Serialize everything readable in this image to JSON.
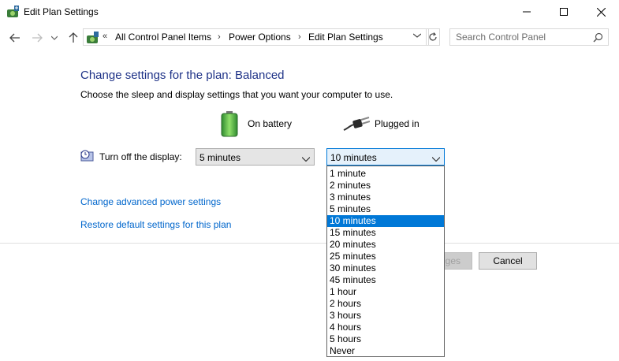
{
  "window": {
    "title": "Edit Plan Settings",
    "controls": [
      "minimize",
      "maximize",
      "close"
    ]
  },
  "nav": {
    "breadcrumb_overflow": "«",
    "breadcrumbs": [
      "All Control Panel Items",
      "Power Options",
      "Edit Plan Settings"
    ],
    "search_placeholder": "Search Control Panel"
  },
  "content": {
    "heading": "Change settings for the plan: Balanced",
    "subheading": "Choose the sleep and display settings that you want your computer to use.",
    "columns": {
      "battery": "On battery",
      "plugged": "Plugged in"
    },
    "display_setting": {
      "label": "Turn off the display:",
      "battery_value": "5 minutes",
      "plugged_value": "10 minutes"
    },
    "links": {
      "advanced": "Change advanced power settings",
      "restore": "Restore default settings for this plan"
    },
    "buttons": {
      "save_partial": "ges",
      "cancel": "Cancel"
    }
  },
  "dropdown": {
    "selected_index": 4,
    "options": [
      "1 minute",
      "2 minutes",
      "3 minutes",
      "5 minutes",
      "10 minutes",
      "15 minutes",
      "20 minutes",
      "25 minutes",
      "30 minutes",
      "45 minutes",
      "1 hour",
      "2 hours",
      "3 hours",
      "4 hours",
      "5 hours",
      "Never"
    ]
  },
  "colors": {
    "heading": "#1e3287",
    "link": "#0066cc",
    "selection": "#0078d7"
  }
}
